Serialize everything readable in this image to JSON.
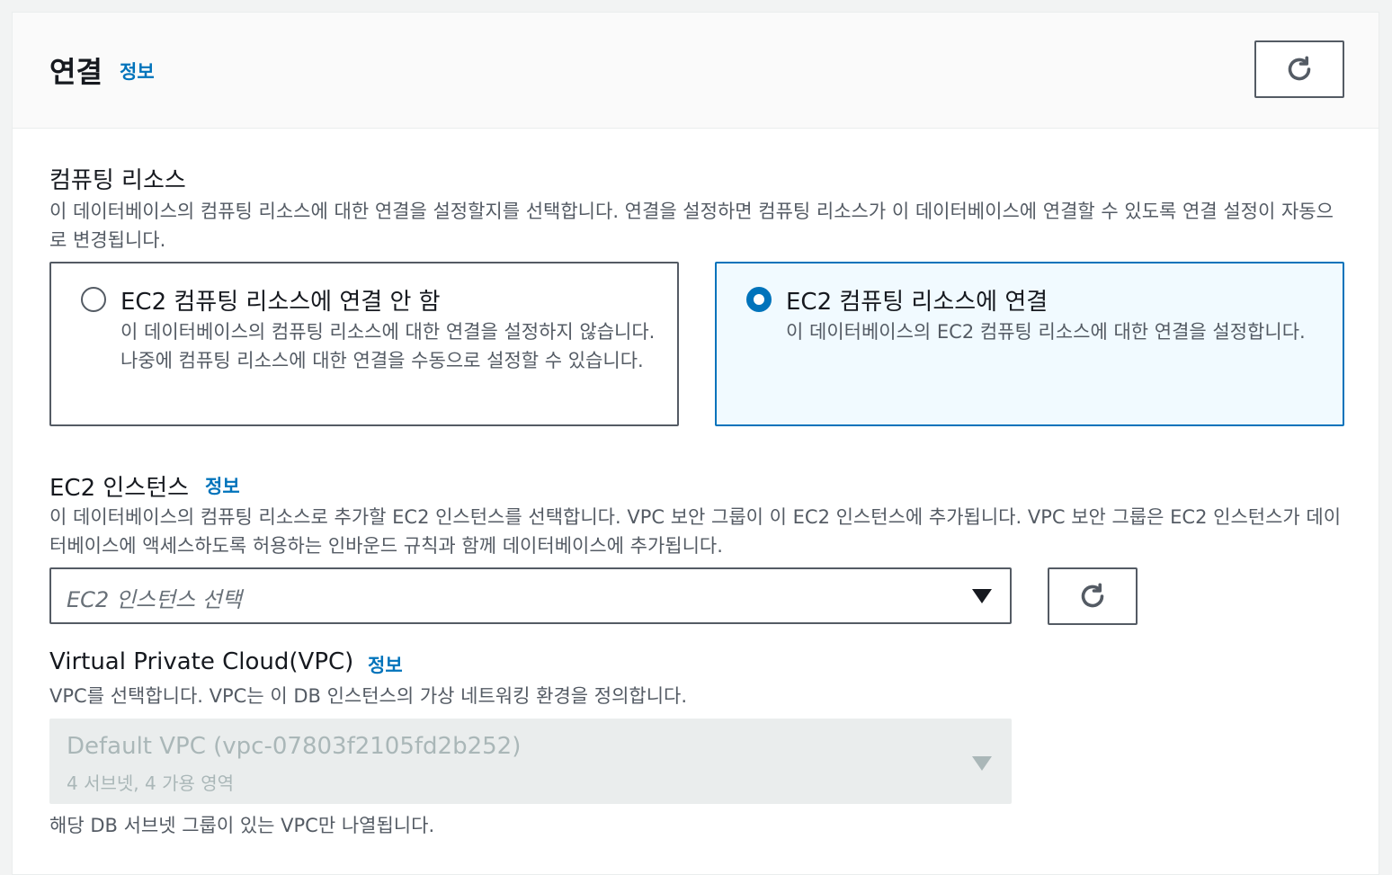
{
  "section": {
    "title": "연결",
    "info_label": "정보"
  },
  "compute": {
    "label": "컴퓨팅 리소스",
    "description": "이 데이터베이스의 컴퓨팅 리소스에 대한 연결을 설정할지를 선택합니다. 연결을 설정하면 컴퓨팅 리소스가 이 데이터베이스에 연결할 수 있도록 연결 설정이 자동으로 변경됩니다.",
    "options": [
      {
        "title": "EC2 컴퓨팅 리소스에 연결 안 함",
        "description": "이 데이터베이스의 컴퓨팅 리소스에 대한 연결을 설정하지 않습니다. 나중에 컴퓨팅 리소스에 대한 연결을 수동으로 설정할 수 있습니다.",
        "selected": false
      },
      {
        "title": "EC2 컴퓨팅 리소스에 연결",
        "description": "이 데이터베이스의 EC2 컴퓨팅 리소스에 대한 연결을 설정합니다.",
        "selected": true
      }
    ]
  },
  "ec2": {
    "label": "EC2 인스턴스",
    "info_label": "정보",
    "description": "이 데이터베이스의 컴퓨팅 리소스로 추가할 EC2 인스턴스를 선택합니다. VPC 보안 그룹이 이 EC2 인스턴스에 추가됩니다. VPC 보안 그룹은 EC2 인스턴스가 데이터베이스에 액세스하도록 허용하는 인바운드 규칙과 함께 데이터베이스에 추가됩니다.",
    "select_placeholder": "EC2 인스턴스 선택"
  },
  "vpc": {
    "label": "Virtual Private Cloud(VPC)",
    "info_label": "정보",
    "description": "VPC를 선택합니다. VPC는 이 DB 인스턴스의 가상 네트워킹 환경을 정의합니다.",
    "selected_value": "Default VPC (vpc-07803f2105fd2b252)",
    "selected_sub": "4 서브넷, 4 가용 영역",
    "hint": "해당 DB 서브넷 그룹이 있는 VPC만 나열됩니다."
  },
  "colors": {
    "accent": "#0073bb",
    "text": "#16191f",
    "secondary_text": "#545b64",
    "disabled_text": "#aab7b8"
  },
  "icons": {
    "refresh": "refresh-icon",
    "caret": "caret-down-icon"
  }
}
